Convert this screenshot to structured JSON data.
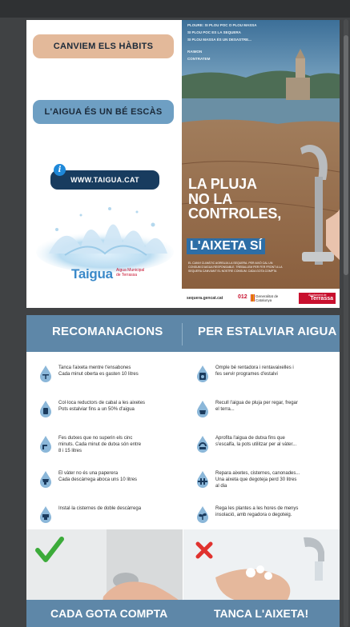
{
  "page1": {
    "pill_habits": "CANVIEM ELS HÀBITS",
    "pill_water": "L'AIGUA ÉS UN BÉ ESCÀS",
    "pill_web": "WWW.TAIGUA.CAT",
    "info_icon": "i",
    "logo_text": "Taigua",
    "logo_sub": "Aigua Municipal de Terrassa",
    "lake_text_1": "PLOURE: SI PLOU POC O PLOU MASSA",
    "lake_text_2": "SI PLOU POC ES LA SEQUERA",
    "lake_text_3": "SI PLOU MASSA ÉS UN DESASTRE...",
    "lake_text_4": "RAIMON",
    "lake_text_5": "CONTRATEM",
    "title_line1": "LA PLUJA",
    "title_line2": "NO LA",
    "title_line3": "CONTROLES,",
    "title_highlight": "L'AIXETA SÍ",
    "small_print": "EL CANVI CLIMÀTIC AGREUJA LA SEQUERA. PER AIXÒ CAL UN CONSUM D'AIGUA RESPONSABLE. TREBALLEM PER FER FRONT A LA SEQUERA CANVIANT EL NOSTRE CONSUM. CADA GOTA COMPTA",
    "footer_url": "sequera.gencat.cat",
    "footer_012": "012",
    "footer_gencat": "Generalitat de Catalunya",
    "footer_ajuntament": "Ajuntament de",
    "footer_terrassa": "Terrassa"
  },
  "page2": {
    "header_left": "RECOMANACIONS",
    "header_right": "PER ESTALVIAR AIGUA",
    "tips_left": [
      {
        "icon": "shower-drop-icon",
        "text": "Tanca l'aixeta mentre t'ensabones\nCada minut oberta es gasten 10 litres"
      },
      {
        "icon": "flow-reducer-drop-icon",
        "text": "Col·loca reductors de cabal a les aixetes\nPots estalviar fins a un 50% d'aigua"
      },
      {
        "icon": "shower-timer-drop-icon",
        "text": "Fes dutxes que no superin els cinc\nminuts. Cada minut de dutxa són entre\n8 i 15 litres"
      },
      {
        "icon": "toilet-drop-icon",
        "text": "El vàter no és una paperera\nCada descàrrega aboca uns 10 litres"
      },
      {
        "icon": "cistern-drop-icon",
        "text": "Instal·la cisternes de doble descàrrega"
      }
    ],
    "tips_right": [
      {
        "icon": "dishwasher-drop-icon",
        "text": "Omple bé rentadora i rentavaixelles i\nfes servir programes d'estalvi"
      },
      {
        "icon": "rain-collect-drop-icon",
        "text": "Recull l'aigua de pluja per regar, fregar\nel terra..."
      },
      {
        "icon": "shower-reuse-drop-icon",
        "text": "Aprofita l'aigua de dutxa fins que\ns'escalfa, la pots utilitzar per al vàter..."
      },
      {
        "icon": "pipes-drop-icon",
        "text": "Repara aixetes, cisternes, canonades...\nUna aixeta que degoteja perd 30 litres\nal dia"
      },
      {
        "icon": "plant-drop-icon",
        "text": "Rega les plantes a les hores de menys\ninsolació, amb regadora o degoteig."
      }
    ],
    "bottom_left": "CADA GOTA COMPTA",
    "bottom_right": "TANCA L'AIXETA!"
  },
  "colors": {
    "header_blue": "#5e87a8",
    "pill_tan": "#e3b99a",
    "pill_blue": "#6e9fc3",
    "web_navy": "#183c5f",
    "brand_red": "#c8102e"
  }
}
